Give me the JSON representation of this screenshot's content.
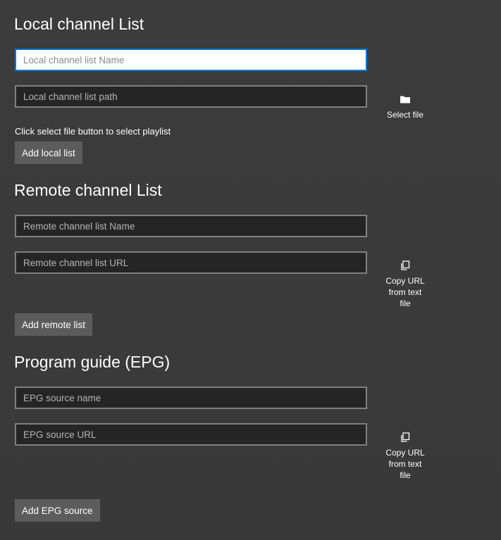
{
  "local": {
    "title": "Local channel List",
    "name_placeholder": "Local channel list Name",
    "path_placeholder": "Local channel list path",
    "select_file_label": "Select file",
    "select_file_icon": "folder-icon",
    "hint": "Click select file button to select playlist",
    "add_label": "Add local list"
  },
  "remote": {
    "title": "Remote channel List",
    "name_placeholder": "Remote channel list Name",
    "url_placeholder": "Remote channel list URL",
    "copy_label_lines": [
      "Copy URL",
      "from text",
      "file"
    ],
    "copy_icon": "copy-icon",
    "add_label": "Add remote list"
  },
  "epg": {
    "title": "Program guide (EPG)",
    "name_placeholder": "EPG source name",
    "url_placeholder": "EPG source URL",
    "copy_label_lines": [
      "Copy URL",
      "from text",
      "file"
    ],
    "copy_icon": "copy-icon",
    "add_label": "Add EPG source"
  },
  "colors": {
    "background": "#3a3a3a",
    "field_background": "#252525",
    "field_border": "#808080",
    "focus_border": "#0078d7",
    "button_background": "#5c5c5c",
    "text": "#ffffff"
  }
}
